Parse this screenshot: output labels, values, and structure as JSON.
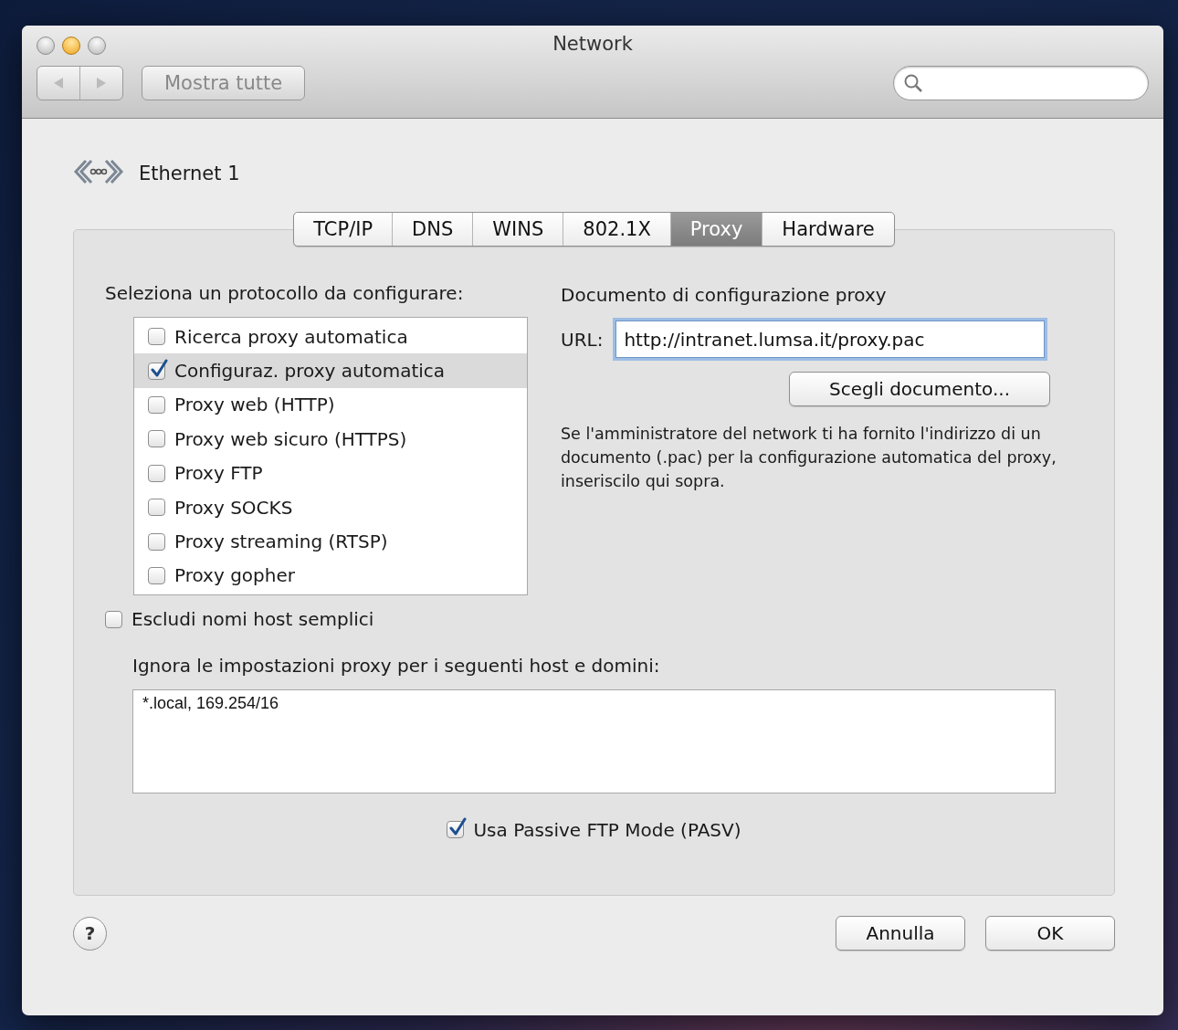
{
  "window": {
    "title": "Network",
    "show_all_button": "Mostra tutte"
  },
  "service": {
    "name": "Ethernet 1"
  },
  "tabs": [
    {
      "label": "TCP/IP",
      "selected": false
    },
    {
      "label": "DNS",
      "selected": false
    },
    {
      "label": "WINS",
      "selected": false
    },
    {
      "label": "802.1X",
      "selected": false
    },
    {
      "label": "Proxy",
      "selected": true
    },
    {
      "label": "Hardware",
      "selected": false
    }
  ],
  "protocols": {
    "label": "Seleziona un protocollo da configurare:",
    "items": [
      {
        "label": "Ricerca proxy automatica",
        "checked": false,
        "selected": false
      },
      {
        "label": "Configuraz. proxy automatica",
        "checked": true,
        "selected": true
      },
      {
        "label": "Proxy web (HTTP)",
        "checked": false,
        "selected": false
      },
      {
        "label": "Proxy web sicuro (HTTPS)",
        "checked": false,
        "selected": false
      },
      {
        "label": "Proxy FTP",
        "checked": false,
        "selected": false
      },
      {
        "label": "Proxy SOCKS",
        "checked": false,
        "selected": false
      },
      {
        "label": "Proxy streaming (RTSP)",
        "checked": false,
        "selected": false
      },
      {
        "label": "Proxy gopher",
        "checked": false,
        "selected": false
      }
    ]
  },
  "proxy_config": {
    "heading": "Documento di configurazione proxy",
    "url_label": "URL:",
    "url_value": "http://intranet.lumsa.it/proxy.pac",
    "choose_button": "Scegli documento...",
    "note": "Se l'amministratore del network ti ha fornito l'indirizzo di un documento (.pac) per la configurazione automatica del proxy, inseriscilo qui sopra."
  },
  "exclude_simple_hosts": {
    "label": "Escludi nomi host semplici",
    "checked": false
  },
  "bypass": {
    "label": "Ignora le impostazioni proxy per i seguenti host e domini:",
    "value": "*.local, 169.254/16"
  },
  "passive_ftp": {
    "label": "Usa Passive FTP Mode (PASV)",
    "checked": true
  },
  "help_button": "?",
  "buttons": [
    "Annulla",
    "OK"
  ]
}
